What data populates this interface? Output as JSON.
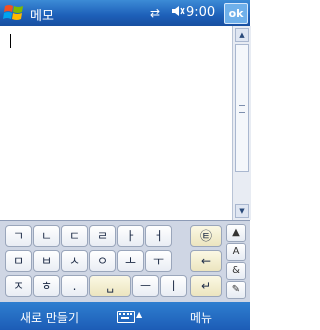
{
  "titlebar": {
    "title": "메모",
    "time": "9:00",
    "ok_label": "ok",
    "connectivity_icon": "⇄",
    "volume_icon": "◀×"
  },
  "keyboard": {
    "rows": [
      [
        "ㄱ",
        "ㄴ",
        "ㄷ",
        "ㄹ",
        "ㅏ",
        "ㅓ",
        "㉫"
      ],
      [
        "ㅁ",
        "ㅂ",
        "ㅅ",
        "ㅇ",
        "ㅗ",
        "ㅜ",
        "←"
      ],
      [
        "ㅈ",
        "ㅎ",
        ".",
        "␣",
        "ㅡ",
        "ㅣ",
        "↵"
      ]
    ],
    "side_keys": [
      "▲",
      "A",
      "&",
      "✎"
    ]
  },
  "scrollbar": {
    "up_icon": "▲",
    "down_icon": "▼"
  },
  "bottom": {
    "left_softkey": "새로 만들기",
    "right_softkey": "메뉴",
    "input_arrow": "▲"
  },
  "colors": {
    "titlebar": "#1d5fb8",
    "keyboard_bg": "#cfd6e4",
    "accent_key": "#ece5bf"
  }
}
